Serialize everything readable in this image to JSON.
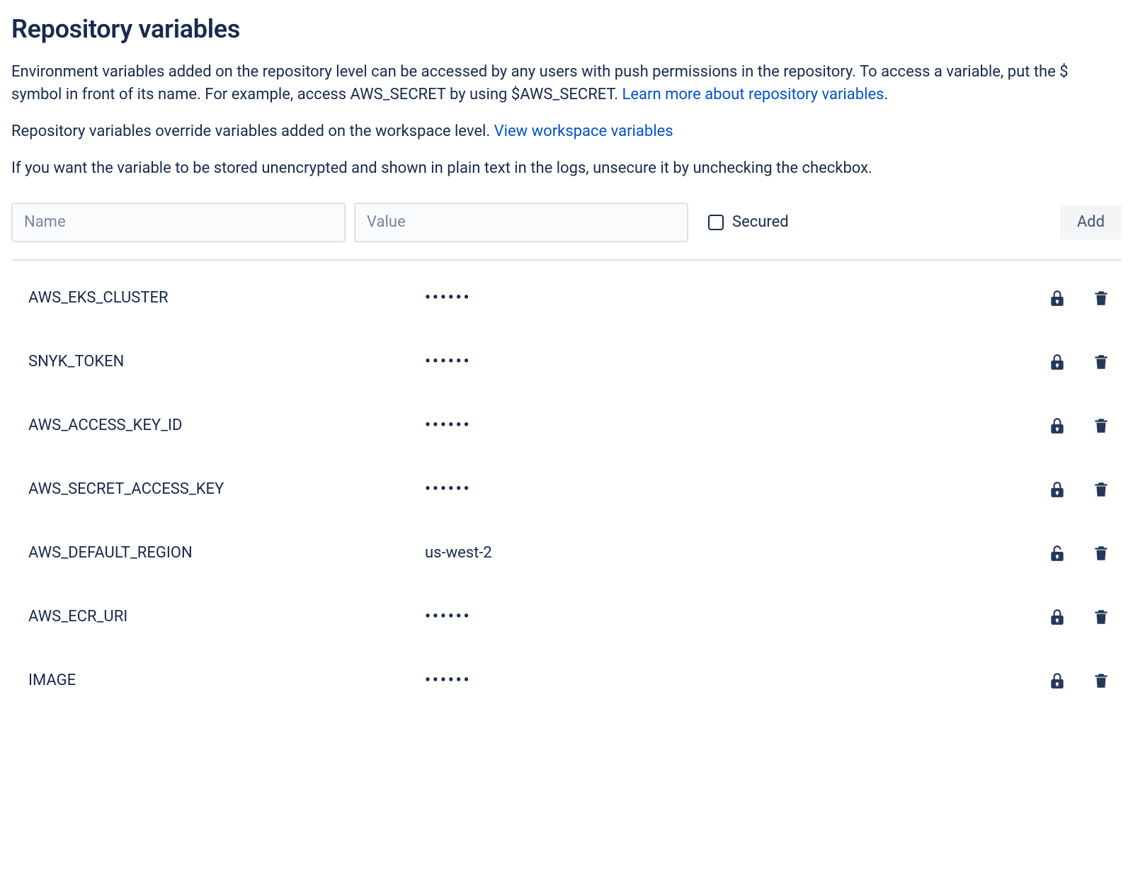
{
  "title": "Repository variables",
  "description": {
    "para1_a": "Environment variables added on the repository level can be accessed by any users with push permissions in the repository. To access a variable, put the $ symbol in front of its name. For example, access AWS_SECRET by using $AWS_SECRET. ",
    "learn_link": "Learn more about repository variables",
    "para1_b": ".",
    "para2_a": "Repository variables override variables added on the workspace level. ",
    "workspace_link": "View workspace variables",
    "para3": "If you want the variable to be stored unencrypted and shown in plain text in the logs, unsecure it by unchecking the checkbox."
  },
  "form": {
    "name_placeholder": "Name",
    "value_placeholder": "Value",
    "secured_label": "Secured",
    "add_label": "Add"
  },
  "masked_value": "••••••",
  "variables": [
    {
      "name": "AWS_EKS_CLUSTER",
      "value": "••••••",
      "secured": true
    },
    {
      "name": "SNYK_TOKEN",
      "value": "••••••",
      "secured": true
    },
    {
      "name": "AWS_ACCESS_KEY_ID",
      "value": "••••••",
      "secured": true
    },
    {
      "name": "AWS_SECRET_ACCESS_KEY",
      "value": "••••••",
      "secured": true
    },
    {
      "name": "AWS_DEFAULT_REGION",
      "value": "us-west-2",
      "secured": false
    },
    {
      "name": "AWS_ECR_URI",
      "value": "••••••",
      "secured": true
    },
    {
      "name": "IMAGE",
      "value": "••••••",
      "secured": true
    }
  ]
}
